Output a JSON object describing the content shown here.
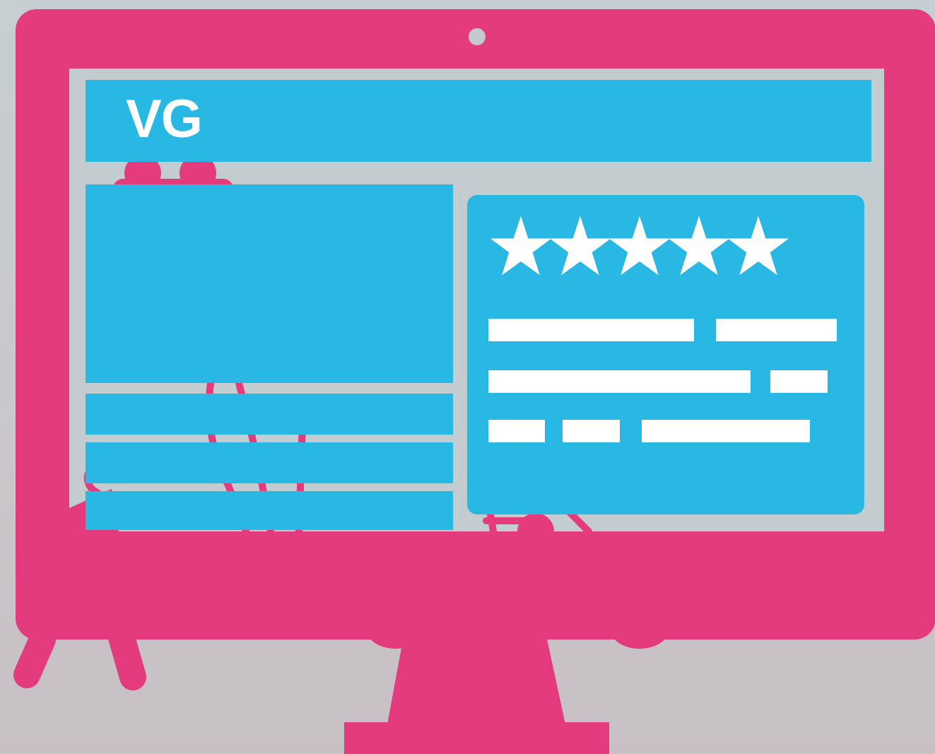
{
  "brand": {
    "logo_text": "VG"
  },
  "review": {
    "rating": 5,
    "rating_max": 5,
    "stars": [
      "star-icon",
      "star-icon",
      "star-icon",
      "star-icon",
      "star-icon"
    ]
  },
  "colors": {
    "monitor": "#e43a7e",
    "screen_bg": "#c3cdd0",
    "panel": "#29b7e3",
    "text_placeholder": "#ffffff",
    "background": "#c7c9cc"
  },
  "icons": {
    "camera": "camera-dot-icon",
    "star": "star-icon",
    "people": "people-silhouette-icon"
  }
}
